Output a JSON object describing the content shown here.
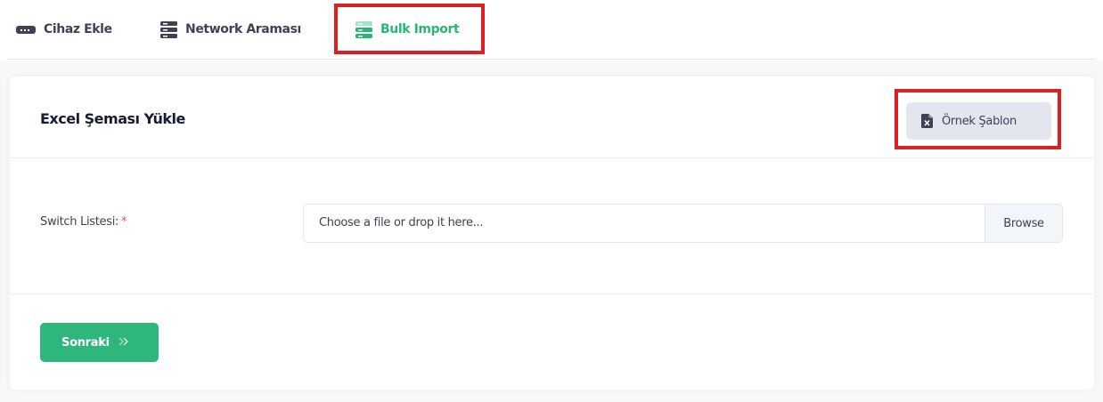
{
  "tabs": [
    {
      "label": "Cihaz Ekle",
      "icon": "device-icon",
      "active": false
    },
    {
      "label": "Network Araması",
      "icon": "server-icon",
      "active": false
    },
    {
      "label": "Bulk Import",
      "icon": "server-stack-icon",
      "active": true
    }
  ],
  "card": {
    "title": "Excel Şeması Yükle",
    "template_button": {
      "label": "Örnek Şablon",
      "icon": "excel-file-icon"
    }
  },
  "form": {
    "switch_list_label": "Switch Listesi:",
    "required_mark": "*",
    "file_placeholder": "Choose a file or drop it here...",
    "browse_label": "Browse"
  },
  "footer": {
    "next_label": "Sonraki",
    "next_icon": "double-chevron-right-icon"
  },
  "colors": {
    "accent_green": "#2fb67d",
    "active_tab_text": "#2bb673",
    "highlight_red": "#dc1f26",
    "required_red": "#f64e60"
  }
}
